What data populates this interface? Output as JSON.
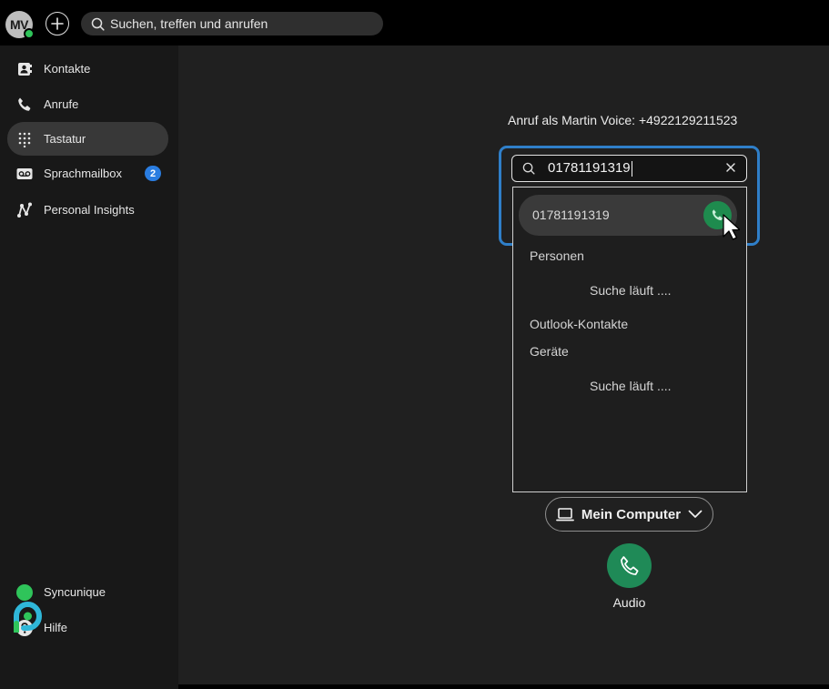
{
  "topbar": {
    "avatar_initials": "MV",
    "search_placeholder": "Suchen, treffen und anrufen"
  },
  "sidebar": {
    "items": [
      {
        "label": "Kontakte",
        "icon": "contacts-icon"
      },
      {
        "label": "Anrufe",
        "icon": "phone-icon"
      },
      {
        "label": "Tastatur",
        "icon": "dialpad-icon",
        "active": true
      },
      {
        "label": "Sprachmailbox",
        "icon": "voicemail-icon",
        "badge": "2"
      },
      {
        "label": "Personal Insights",
        "icon": "insights-icon"
      }
    ],
    "bottom_items": [
      {
        "label": "Syncunique",
        "icon": "status-dot-icon"
      },
      {
        "label": "Hilfe",
        "icon": "help-icon"
      }
    ]
  },
  "dialer": {
    "call_as": "Anruf als Martin Voice: +4922129211523",
    "input_value": "01781191319",
    "suggestion_number": "01781191319",
    "sections": {
      "people": "Personen",
      "people_status": "Suche läuft ....",
      "outlook": "Outlook-Kontakte",
      "devices": "Geräte",
      "devices_status": "Suche läuft ...."
    },
    "device_label": "Mein Computer",
    "audio_label": "Audio"
  },
  "colors": {
    "accent_blue": "#2f7fc9",
    "call_green": "#1f8a57",
    "presence_green": "#2fc45a",
    "badge_blue": "#2a7de1"
  }
}
